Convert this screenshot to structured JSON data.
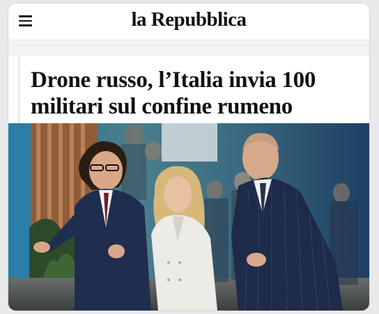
{
  "header": {
    "brand": "la Repubblica",
    "menu_icon": "hamburger-menu-icon"
  },
  "article": {
    "headline": "Drone russo, l’Italia invia 100 militari sul confine rumeno",
    "photo_description_icon": "news-photo"
  },
  "colors": {
    "page_bg": "#e9e9e9",
    "card_bg": "#ffffff",
    "text": "#111111",
    "navy_suit": "#1f2d4f",
    "white_jacket": "#ecebe6"
  }
}
